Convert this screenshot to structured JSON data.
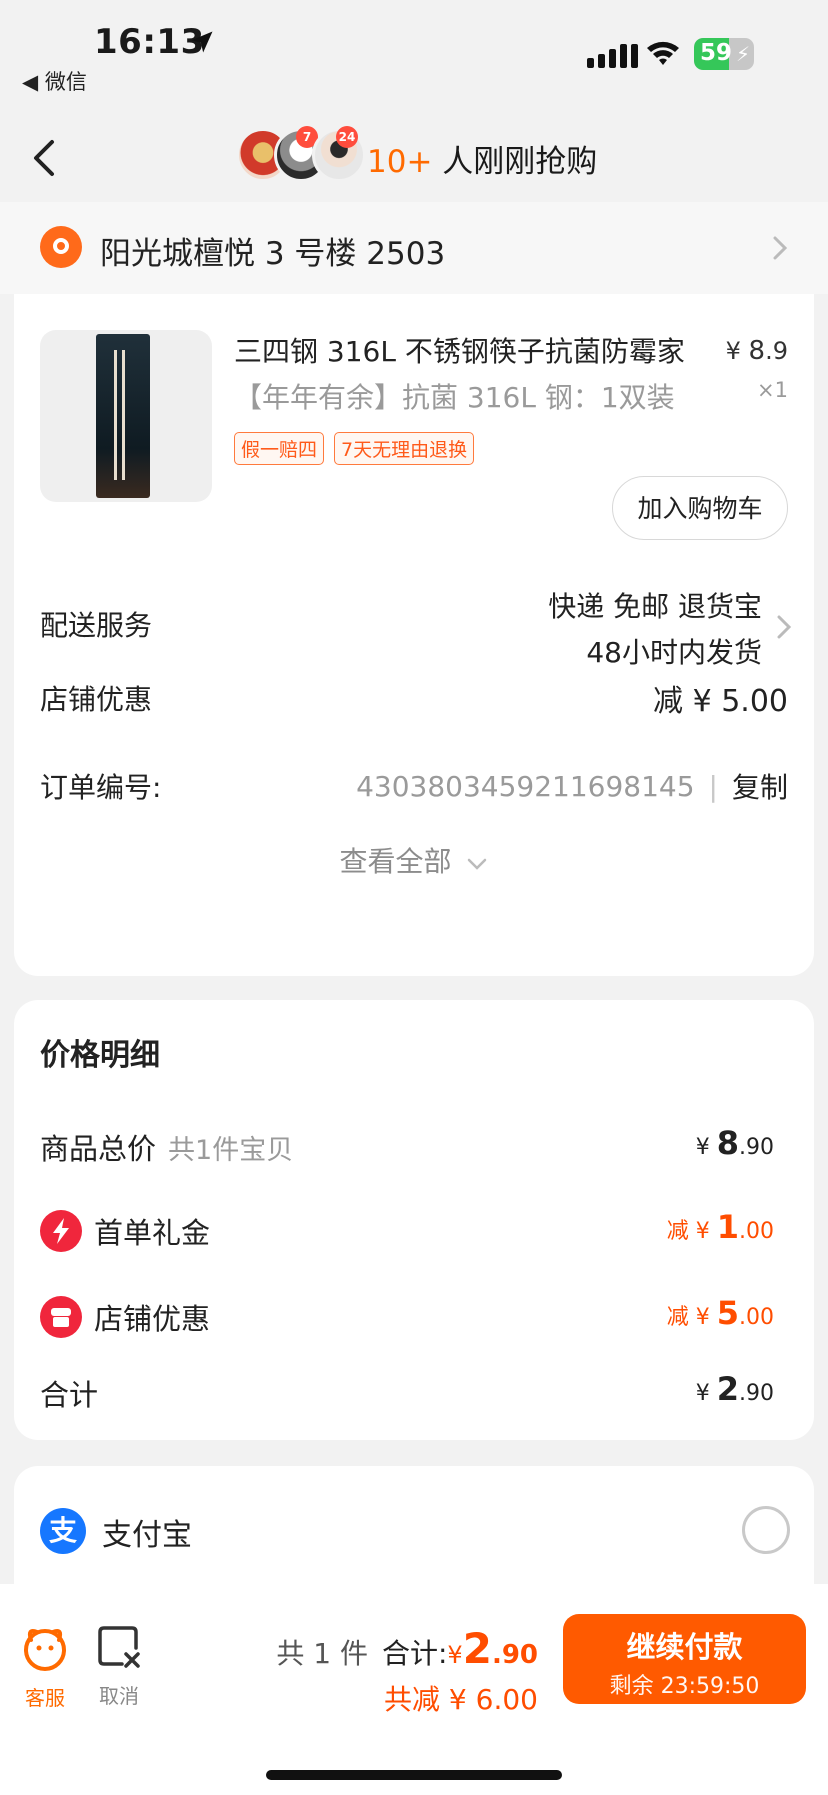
{
  "status_bar": {
    "time": "16:13",
    "back_app": "◀ 微信",
    "battery": "59"
  },
  "nav": {
    "count_text": "10+",
    "title_text": " 人刚刚抢购",
    "avatar_badges": [
      "7",
      "24"
    ]
  },
  "address": {
    "text": "阳光城檀悦 3 号楼 2503"
  },
  "product": {
    "title": "三四钢 316L 不锈钢筷子抗菌防霉家",
    "sku": "【年年有余】抗菌 316L 钢：1双装",
    "price_currency": "¥",
    "price_int": "8",
    "price_dec": ".9",
    "quantity": "×1",
    "tags": [
      "假一赔四",
      "7天无理由退换"
    ],
    "add_cart_label": "加入购物车"
  },
  "delivery": {
    "label": "配送服务",
    "line1": "快递 免邮 退货宝",
    "line2": "48小时内发货"
  },
  "shop_discount": {
    "label": "店铺优惠",
    "value": "减 ¥ 5.00"
  },
  "order": {
    "label": "订单编号:",
    "number": "4303803459211698145",
    "separator": "|",
    "copy_label": "复制"
  },
  "view_all": {
    "label": "查看全部"
  },
  "price_detail": {
    "title": "价格明细",
    "rows": [
      {
        "label": "商品总价",
        "sub": "共1件宝贝",
        "prefix": "",
        "currency": "¥ ",
        "int": "8",
        "dec": ".90"
      },
      {
        "label": "首单礼金",
        "sub": "",
        "prefix": "减 ",
        "currency": "¥ ",
        "int": "1",
        "dec": ".00"
      },
      {
        "label": "店铺优惠",
        "sub": "",
        "prefix": "减 ",
        "currency": "¥ ",
        "int": "5",
        "dec": ".00"
      },
      {
        "label": "合计",
        "sub": "",
        "prefix": "",
        "currency": "¥ ",
        "int": "2",
        "dec": ".90"
      }
    ]
  },
  "payment": {
    "method": "支付宝",
    "icon_char": "支"
  },
  "bottom": {
    "service_label": "客服",
    "cancel_label": "取消",
    "items_count": "共 1 件",
    "total_label": "合计:",
    "total_currency": "¥",
    "total_int": "2",
    "total_dec": ".90",
    "saved_text": "共减 ¥ 6.00",
    "pay_label": "继续付款",
    "remaining_text": "剩余 23:59:50"
  },
  "colors": {
    "accent": "#ff5a00",
    "price_red": "#ff4d00",
    "alipay_blue": "#1677ff",
    "battery_green": "#35c759"
  }
}
